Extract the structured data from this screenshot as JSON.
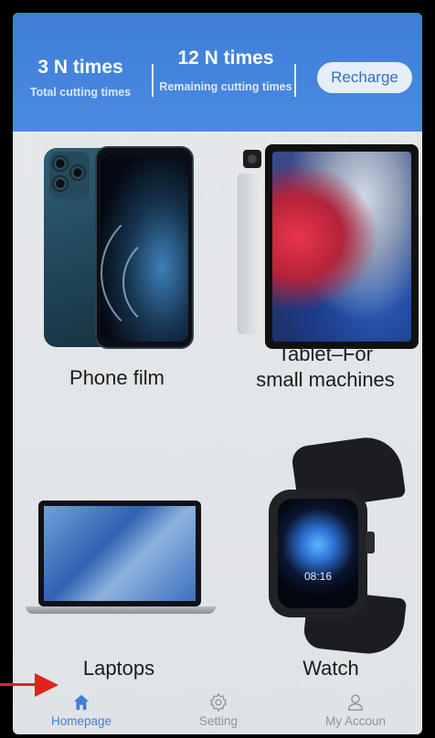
{
  "header": {
    "total": {
      "value": "3 N times",
      "label": "Total cutting times"
    },
    "remaining": {
      "value": "12 N times",
      "label": "Remaining cutting times"
    },
    "recharge_label": "Recharge"
  },
  "categories": [
    {
      "title": "Phone film"
    },
    {
      "title_line1": "Tablet–For",
      "title_line2": "small machines"
    },
    {
      "title": "Laptops"
    },
    {
      "title": "Watch"
    }
  ],
  "watch_time": "08:16",
  "nav": [
    {
      "label": "Homepage",
      "icon": "home-icon",
      "active": true
    },
    {
      "label": "Setting",
      "icon": "gear-icon",
      "active": false
    },
    {
      "label": "My Accoun",
      "icon": "user-icon",
      "active": false
    }
  ],
  "colors": {
    "header_blue": "#4a8ae0",
    "accent": "#3f7ed8",
    "annotation_arrow": "#e2231a"
  }
}
